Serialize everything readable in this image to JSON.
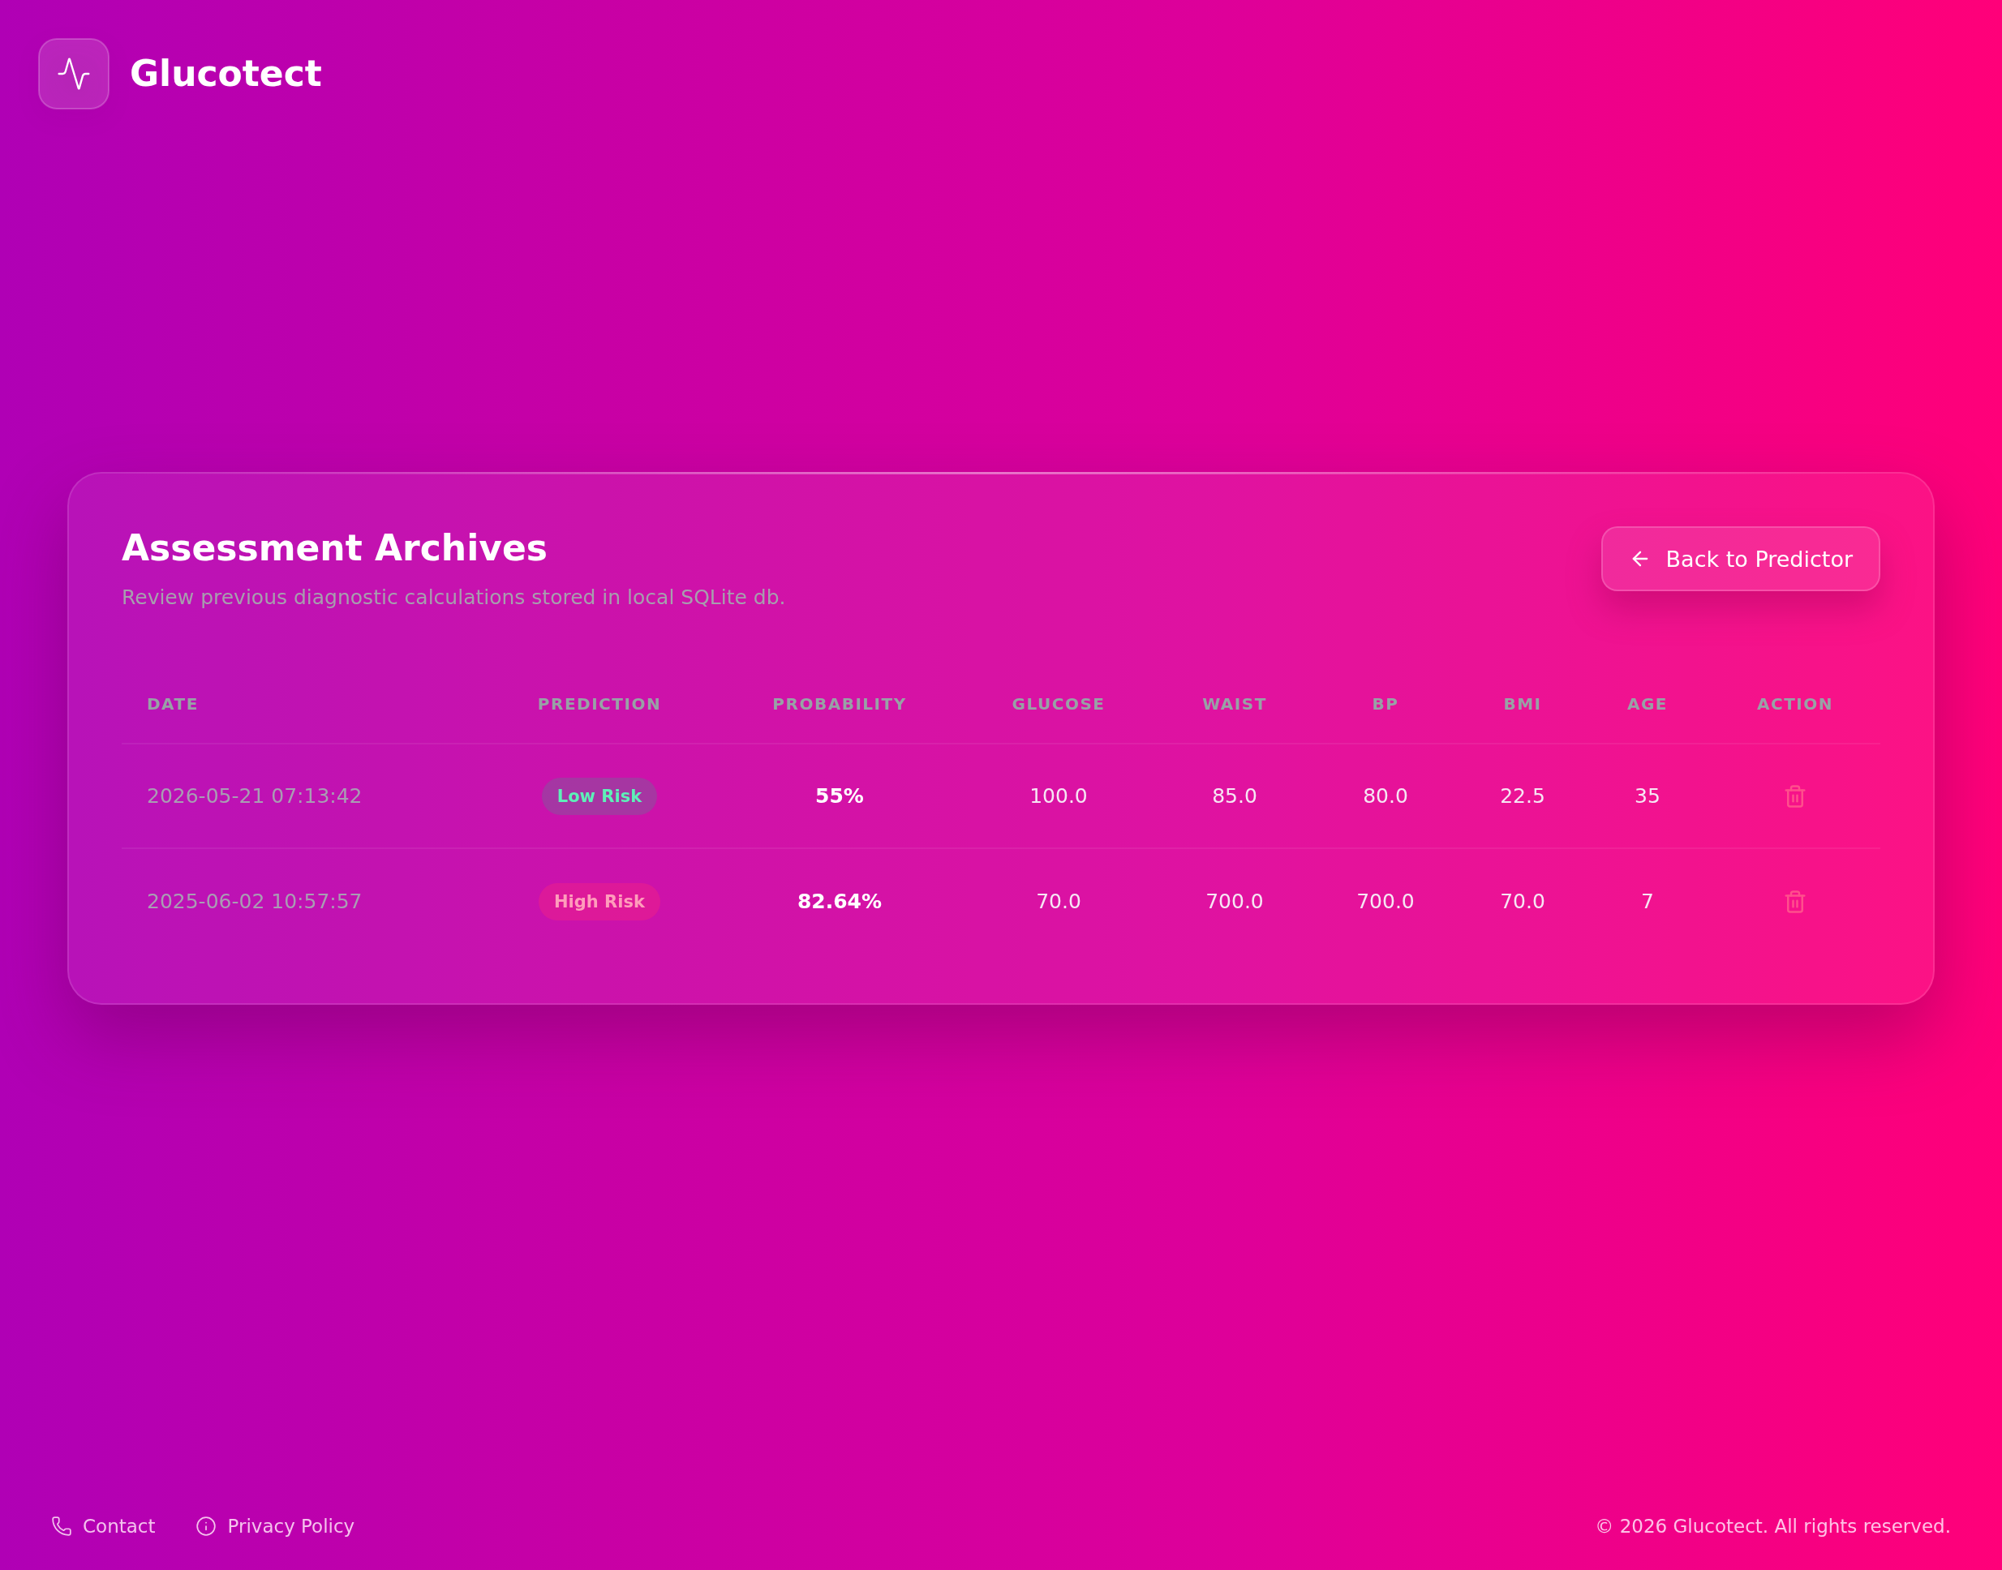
{
  "header": {
    "brand": "Glucotect"
  },
  "archive": {
    "title": "Assessment Archives",
    "subtitle": "Review previous diagnostic calculations stored in local SQLite db.",
    "back_button": {
      "label": "Back to Predictor"
    },
    "table": {
      "columns": [
        {
          "label": "DATE"
        },
        {
          "label": "PREDICTION"
        },
        {
          "label": "PROBABILITY"
        },
        {
          "label": "GLUCOSE"
        },
        {
          "label": "WAIST"
        },
        {
          "label": "BP"
        },
        {
          "label": "BMI"
        },
        {
          "label": "AGE"
        },
        {
          "label": "ACTION"
        }
      ],
      "rows": [
        {
          "date": "2026-05-21 07:13:42",
          "prediction": {
            "label": "Low Risk",
            "kind": "low"
          },
          "probability": "55%",
          "glucose": "100.0",
          "waist": "85.0",
          "bp": "80.0",
          "bmi": "22.5",
          "age": "35"
        },
        {
          "date": "2025-06-02 10:57:57",
          "prediction": {
            "label": "High Risk",
            "kind": "high"
          },
          "probability": "82.64%",
          "glucose": "70.0",
          "waist": "700.0",
          "bp": "700.0",
          "bmi": "70.0",
          "age": "7"
        }
      ]
    }
  },
  "footer": {
    "links": [
      {
        "label": "Contact",
        "kind": "phone"
      },
      {
        "label": "Privacy Policy",
        "kind": "info"
      }
    ],
    "copyright": "© 2026 Glucotect. All rights reserved."
  }
}
